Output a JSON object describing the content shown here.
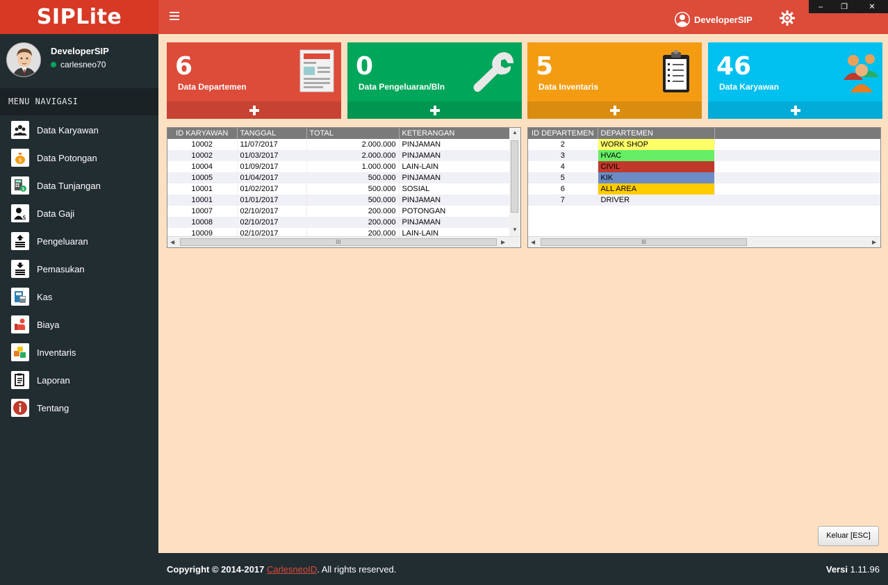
{
  "brand": "SIPLite",
  "user": {
    "name": "DeveloperSIP",
    "username": "carlesneo70"
  },
  "menu_header": "MENU NAVIGASI",
  "menu": [
    {
      "label": "Data Karyawan",
      "icon": "users-icon"
    },
    {
      "label": "Data Potongan",
      "icon": "money-bag-icon"
    },
    {
      "label": "Data Tunjangan",
      "icon": "calculator-icon"
    },
    {
      "label": "Data Gaji",
      "icon": "salary-user-icon"
    },
    {
      "label": "Pengeluaran",
      "icon": "coins-out-icon"
    },
    {
      "label": "Pemasukan",
      "icon": "coins-in-icon"
    },
    {
      "label": "Kas",
      "icon": "cash-register-icon"
    },
    {
      "label": "Biaya",
      "icon": "cost-hand-icon"
    },
    {
      "label": "Inventaris",
      "icon": "boxes-icon"
    },
    {
      "label": "Laporan",
      "icon": "report-icon"
    },
    {
      "label": "Tentang",
      "icon": "info-icon"
    }
  ],
  "header": {
    "user": "DeveloperSIP"
  },
  "window": {
    "minimize": "‒",
    "restore": "❐",
    "close": "✕"
  },
  "cards": [
    {
      "num": "6",
      "title": "Data Departemen",
      "color": "#dd4b39",
      "foot": "#c64333",
      "icon": "document-icon"
    },
    {
      "num": "0",
      "title": "Data Pengeluaran/Bln",
      "color": "#00a65a",
      "foot": "#009551",
      "icon": "wrench-icon"
    },
    {
      "num": "5",
      "title": "Data Inventaris",
      "color": "#f39c12",
      "foot": "#da8c10",
      "icon": "clipboard-icon"
    },
    {
      "num": "46",
      "title": "Data Karyawan",
      "color": "#00c0ef",
      "foot": "#00acd7",
      "icon": "people-icon"
    }
  ],
  "karyawan_table": {
    "headers": [
      "ID KARYAWAN",
      "TANGGAL",
      "TOTAL",
      "KETERANGAN"
    ],
    "rows": [
      [
        "10002",
        "11/07/2017",
        "2.000.000",
        "PINJAMAN"
      ],
      [
        "10002",
        "01/03/2017",
        "2.000.000",
        "PINJAMAN"
      ],
      [
        "10004",
        "01/09/2017",
        "1.000.000",
        "LAIN-LAIN"
      ],
      [
        "10005",
        "01/04/2017",
        "500.000",
        "PINJAMAN"
      ],
      [
        "10001",
        "01/02/2017",
        "500.000",
        "SOSIAL"
      ],
      [
        "10001",
        "01/01/2017",
        "500.000",
        "PINJAMAN"
      ],
      [
        "10007",
        "02/10/2017",
        "200.000",
        "POTONGAN"
      ],
      [
        "10008",
        "02/10/2017",
        "200.000",
        "PINJAMAN"
      ],
      [
        "10009",
        "02/10/2017",
        "200.000",
        "LAIN-LAIN"
      ]
    ]
  },
  "departemen_table": {
    "headers": [
      "ID DEPARTEMEN",
      "DEPARTEMEN",
      ""
    ],
    "rows": [
      {
        "id": "2",
        "name": "WORK SHOP",
        "color": "#ffff66"
      },
      {
        "id": "3",
        "name": "HVAC",
        "color": "#66ee66"
      },
      {
        "id": "4",
        "name": "CIVIL",
        "color": "#c0392b"
      },
      {
        "id": "5",
        "name": "KIK",
        "color": "#6b8cc7"
      },
      {
        "id": "6",
        "name": "ALL AREA",
        "color": "#ffcc00"
      },
      {
        "id": "7",
        "name": "DRIVER",
        "color": ""
      }
    ]
  },
  "scroll_thumb_label": "III",
  "keluar": "Keluar [ESC]",
  "footer": {
    "copy_prefix": "Copyright © 2014-2017 ",
    "copy_link": "CarlesneoID",
    "copy_suffix": ". All rights reserved.",
    "version_label": "Versi",
    "version": "1.11.96"
  }
}
